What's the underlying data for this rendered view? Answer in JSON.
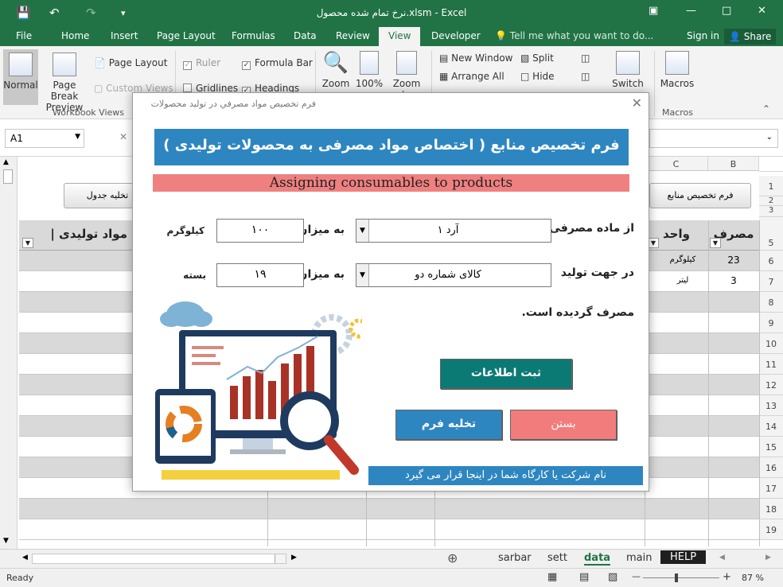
{
  "titlebar": {
    "title": "نرخ تمام شده محصول.xlsm - Excel",
    "save_icon": "save-icon",
    "undo_icon": "undo-icon",
    "redo_icon": "redo-icon"
  },
  "ribbon_tabs": [
    "File",
    "Home",
    "Insert",
    "Page Layout",
    "Formulas",
    "Data",
    "Review",
    "View",
    "Developer"
  ],
  "tell_me": "Tell me what you want to do...",
  "account": {
    "signin": "Sign in",
    "share": "Share"
  },
  "ribbon": {
    "workbook_views": {
      "normal": "Normal",
      "page_break": "Page Break Preview",
      "page_layout": "Page Layout",
      "custom_views": "Custom Views",
      "group": "Workbook Views"
    },
    "show": {
      "ruler": "Ruler",
      "formula_bar": "Formula Bar",
      "gridlines": "Gridlines",
      "headings": "Headings"
    },
    "zoom": {
      "zoom": "Zoom",
      "hundred": "100%",
      "zoom_to": "Zoom to"
    },
    "window": {
      "new_window": "New Window",
      "arrange_all": "Arrange All",
      "split": "Split",
      "hide": "Hide",
      "switch": "Switch"
    },
    "macros": {
      "macros": "Macros",
      "group": "Macros"
    }
  },
  "namebox": "A1",
  "grid": {
    "col_headers": [
      "B",
      "C"
    ],
    "row_numbers": [
      "1",
      "2",
      "3",
      "5",
      "6",
      "7",
      "8",
      "9",
      "10",
      "11",
      "12",
      "13",
      "14",
      "15",
      "16",
      "17",
      "18",
      "19"
    ],
    "btn_allocation_form": "فرم تخصیص منابع",
    "btn_clear_table": "تخلیه جدول",
    "head_consumption": "مصرف",
    "head_unit": "واحد",
    "head_materials": "| مواد تولیدی",
    "rows": [
      {
        "consumption": "23",
        "unit": "کیلوگرم"
      },
      {
        "consumption": "3",
        "unit": "لیتر"
      }
    ]
  },
  "sheets": [
    "sarbar",
    "sett",
    "data",
    "main",
    "HELP"
  ],
  "status": {
    "ready": "Ready",
    "zoom": "87 %"
  },
  "dialog": {
    "window_title": "فرم تخصیص مواد مصرفي در تولید محصولات",
    "header_fa": "فرم تخصیص منابع ( اختصاص مواد مصرفی به محصولات تولیدی )",
    "header_en": "Assigning consumables to products",
    "lbl_from_material": "از ماده مصرفی",
    "material_value": "آرد ۱",
    "lbl_amount1": "به میزان",
    "amount1": "۱۰۰",
    "unit1": "کیلوگرم",
    "lbl_for_product": "در جهت تولید",
    "product_value": "کالای شماره دو",
    "lbl_amount2": "به میزان",
    "amount2": "۱۹",
    "unit2": "بسته",
    "lbl_consumed": "مصرف گردیده است.",
    "btn_save": "ثبت اطلاعات",
    "btn_close": "بستن",
    "btn_clear": "تخلیه فرم",
    "footer_text": "نام شرکت یا کارگاه شما در اینجا قرار می گیرد",
    "colors": {
      "header_blue": "#2e86c1",
      "header_pink": "#f08080",
      "save_green": "#0b7a75",
      "close_pink": "#f27c7c",
      "clear_blue": "#2e86c1"
    }
  }
}
